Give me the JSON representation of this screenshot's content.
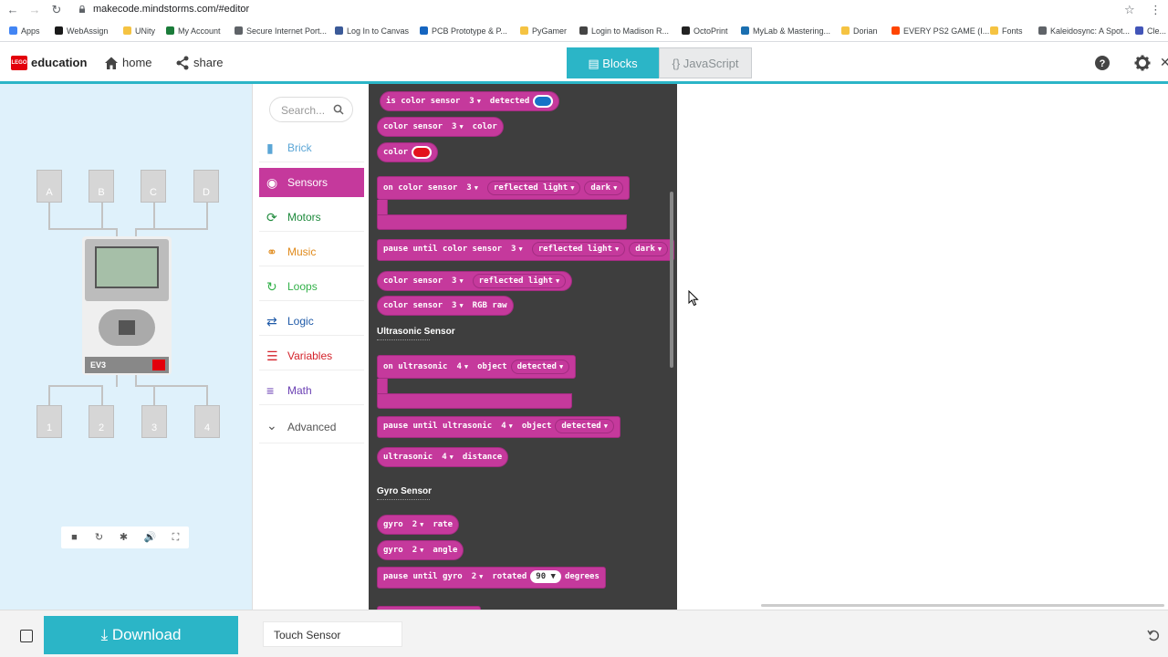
{
  "browser": {
    "url": "makecode.mindstorms.com/#editor",
    "bookmarks": [
      {
        "label": "Apps",
        "icon": "apps-grid-icon",
        "color": "#4285f4"
      },
      {
        "label": "WebAssign",
        "icon": "webassign-icon",
        "color": "#1a1a1a"
      },
      {
        "label": "UNity",
        "icon": "folder-icon",
        "color": "#f5c342"
      },
      {
        "label": "My Account",
        "icon": "account-icon",
        "color": "#1b7c3a"
      },
      {
        "label": "Secure Internet Port...",
        "icon": "globe-icon",
        "color": "#5f6368"
      },
      {
        "label": "Log In to Canvas",
        "icon": "canvas-icon",
        "color": "#3b5a98"
      },
      {
        "label": "PCB Prototype & P...",
        "icon": "pcb-icon",
        "color": "#1565c0"
      },
      {
        "label": "PyGamer",
        "icon": "folder-icon",
        "color": "#f5c342"
      },
      {
        "label": "Login to Madison R...",
        "icon": "madison-icon",
        "color": "#444"
      },
      {
        "label": "OctoPrint",
        "icon": "octoprint-icon",
        "color": "#222"
      },
      {
        "label": "MyLab & Mastering...",
        "icon": "mylab-icon",
        "color": "#1a6fb0"
      },
      {
        "label": "Dorian",
        "icon": "folder-icon",
        "color": "#f5c342"
      },
      {
        "label": "EVERY PS2 GAME (I...",
        "icon": "reddit-icon",
        "color": "#ff4500"
      },
      {
        "label": "Fonts",
        "icon": "folder-icon",
        "color": "#f5c342"
      },
      {
        "label": "Kaleidosync: A Spot...",
        "icon": "globe-icon",
        "color": "#5f6368"
      },
      {
        "label": "Cle...",
        "icon": "clever-icon",
        "color": "#4255b8"
      }
    ]
  },
  "header": {
    "logo_text": "education",
    "logo_brand": "LEGO",
    "home_label": "home",
    "share_label": "share",
    "blocks_label": "Blocks",
    "javascript_label": "{} JavaScript"
  },
  "simulator": {
    "ports_top": [
      "A",
      "B",
      "C",
      "D"
    ],
    "ports_bottom": [
      "1",
      "2",
      "3",
      "4"
    ],
    "brick_label": "EV3"
  },
  "toolbox": {
    "search_placeholder": "Search...",
    "categories": [
      {
        "label": "Brick",
        "color": "#5ba6d6",
        "icon": "brick-icon"
      },
      {
        "label": "Sensors",
        "color": "#c5399c",
        "icon": "sensor-icon",
        "selected": true
      },
      {
        "label": "Motors",
        "color": "#1e8a3c",
        "icon": "motor-icon"
      },
      {
        "label": "Music",
        "color": "#e08a1b",
        "icon": "headphones-icon"
      },
      {
        "label": "Loops",
        "color": "#33b14a",
        "icon": "loop-icon"
      },
      {
        "label": "Logic",
        "color": "#1f5aa8",
        "icon": "logic-icon"
      },
      {
        "label": "Variables",
        "color": "#d4222a",
        "icon": "variables-icon"
      },
      {
        "label": "Math",
        "color": "#6a3fb3",
        "icon": "math-icon"
      },
      {
        "label": "Advanced",
        "color": "#555555",
        "icon": "chevron-down-icon"
      }
    ]
  },
  "flyout": {
    "block_color": "#c5399c",
    "blocks": {
      "is_color": {
        "pre": "is color sensor",
        "port": "3",
        "post": "detected",
        "swatch": "#1673c7"
      },
      "color_sensor_color": {
        "pre": "color sensor",
        "port": "3",
        "post": "color"
      },
      "color": {
        "pre": "color",
        "swatch": "#e3131d"
      },
      "on_color": {
        "pre": "on color sensor",
        "port": "3",
        "mode": "reflected light",
        "level": "dark"
      },
      "pause_color": {
        "pre": "pause until color sensor",
        "port": "3",
        "mode": "reflected light",
        "level": "dark"
      },
      "cs_reflected": {
        "pre": "color sensor",
        "port": "3",
        "mode": "reflected light"
      },
      "cs_rgb": {
        "pre": "color sensor",
        "port": "3",
        "post": "RGB raw"
      },
      "on_ultra": {
        "pre": "on ultrasonic",
        "port": "4",
        "post": "object",
        "event": "detected"
      },
      "pause_ultra": {
        "pre": "pause until ultrasonic",
        "port": "4",
        "post": "object",
        "event": "detected"
      },
      "ultra_dist": {
        "pre": "ultrasonic",
        "port": "4",
        "post": "distance"
      },
      "gyro_rate": {
        "pre": "gyro",
        "port": "2",
        "post": "rate"
      },
      "gyro_angle": {
        "pre": "gyro",
        "port": "2",
        "post": "angle"
      },
      "pause_gyro": {
        "pre": "pause until gyro",
        "port": "2",
        "post": "rotated",
        "value": "90",
        "unit": "degrees"
      }
    },
    "section_ultrasonic": "Ultrasonic Sensor",
    "section_gyro": "Gyro Sensor"
  },
  "footer": {
    "download_label": "Download",
    "project_name": "Touch Sensor"
  }
}
